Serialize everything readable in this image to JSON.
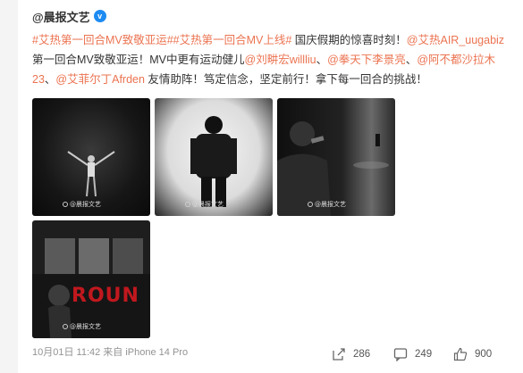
{
  "post": {
    "username": "@晨报文艺",
    "verified_mark": "v",
    "text": [
      {
        "t": "#艾热第一回合MV致敬亚运##艾热第一回合MV上线#",
        "c": "orange"
      },
      {
        "t": " 国庆假期的惊喜时刻！",
        "c": ""
      },
      {
        "t": "@艾热AIR_uugabiz",
        "c": "orange"
      },
      {
        "t": " 第一回合MV致敬亚运！MV中更有运动健儿",
        "c": ""
      },
      {
        "t": "@刘畊宏willliu",
        "c": "orange"
      },
      {
        "t": "、",
        "c": ""
      },
      {
        "t": "@拳天下李景亮",
        "c": "orange"
      },
      {
        "t": "、",
        "c": ""
      },
      {
        "t": "@阿不都沙拉木23",
        "c": "orange"
      },
      {
        "t": "、",
        "c": ""
      },
      {
        "t": "@艾菲尔丁Afrden",
        "c": "orange"
      },
      {
        "t": " 友情助阵！笃定信念，坚定前行！拿下每一回合的挑战！",
        "c": ""
      }
    ],
    "images": [
      {
        "name": "image-1",
        "watermark": "@晨报文艺"
      },
      {
        "name": "image-2",
        "watermark": "@晨报文艺"
      },
      {
        "name": "image-3",
        "watermark": "@晨报文艺"
      },
      {
        "name": "image-4",
        "watermark": "@晨报文艺",
        "overlay_text": "ROUN"
      }
    ],
    "meta": "10月01日 11:42 来自 iPhone 14 Pro",
    "actions": {
      "share_count": "286",
      "comment_count": "249",
      "like_count": "900"
    },
    "colors": {
      "link": "#eb7350",
      "verified": "#1d8bf1"
    }
  }
}
